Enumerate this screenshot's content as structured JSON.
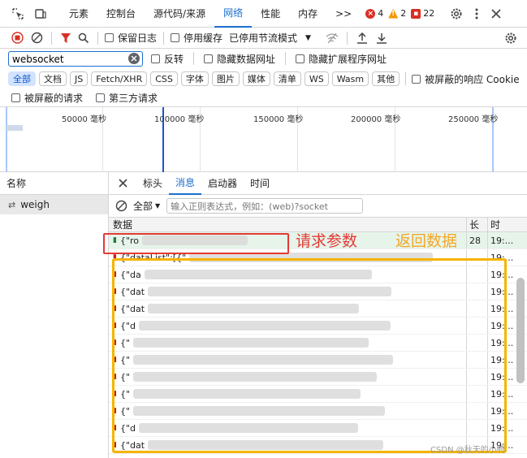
{
  "tabbar": {
    "tabs": [
      "元素",
      "控制台",
      "源代码/来源",
      "网络",
      "性能",
      "内存"
    ],
    "active_tab": "网络",
    "more": ">>",
    "errors": "4",
    "warnings": "2",
    "issues": "22"
  },
  "toolbar": {
    "preserve_log": "保留日志",
    "disable_cache": "停用缓存",
    "throttle": "已停用节流模式"
  },
  "filter": {
    "value": "websocket",
    "invert": "反转",
    "hide_data_urls": "隐藏数据网址",
    "hide_extension_urls": "隐藏扩展程序网址",
    "types": [
      "全部",
      "文档",
      "JS",
      "Fetch/XHR",
      "CSS",
      "字体",
      "图片",
      "媒体",
      "清单",
      "WS",
      "Wasm",
      "其他"
    ],
    "active_type": "全部",
    "blocked_cookies": "被屏蔽的响应 Cookie",
    "blocked_requests": "被屏蔽的请求",
    "third_party": "第三方请求"
  },
  "timeline": {
    "ticks": [
      "50000 毫秒",
      "100000 毫秒",
      "150000 毫秒",
      "200000 毫秒",
      "250000 毫秒"
    ]
  },
  "left_panel": {
    "header": "名称",
    "item": "weigh"
  },
  "detail": {
    "tabs": [
      "标头",
      "消息",
      "启动器",
      "时间"
    ],
    "active_tab": "消息",
    "message_filter": "全部",
    "regex_placeholder": "输入正则表达式，例如：(web)?socket"
  },
  "messages": {
    "col_data": "数据",
    "col_length": "长",
    "col_time": "时",
    "rows": [
      {
        "dir": "up",
        "data": "{\"ro",
        "length": "28",
        "time": "19:..."
      },
      {
        "dir": "down",
        "data": "{\"dataList\":[{\"",
        "length": "",
        "time": "19:..."
      },
      {
        "dir": "down",
        "data": "{\"da",
        "length": "",
        "time": "19:..."
      },
      {
        "dir": "down",
        "data": "{\"dat",
        "length": "",
        "time": "19:..."
      },
      {
        "dir": "down",
        "data": "{\"dat",
        "length": "",
        "time": "19:..."
      },
      {
        "dir": "down",
        "data": "{\"d",
        "length": "",
        "time": "19:..."
      },
      {
        "dir": "down",
        "data": "{\"",
        "length": "",
        "time": "19:..."
      },
      {
        "dir": "down",
        "data": "{\"",
        "length": "",
        "time": "19:..."
      },
      {
        "dir": "down",
        "data": "{\"",
        "length": "",
        "time": "19:..."
      },
      {
        "dir": "down",
        "data": "{\"",
        "length": "",
        "time": "19:..."
      },
      {
        "dir": "down",
        "data": "{\"",
        "length": "",
        "time": "19:..."
      },
      {
        "dir": "down",
        "data": "{\"d",
        "length": "",
        "time": "19:..."
      },
      {
        "dir": "down",
        "data": "{\"dat",
        "length": "",
        "time": "19:..."
      }
    ]
  },
  "annotations": {
    "request_params": "请求参数",
    "return_data": "返回数据",
    "red_color": "#e53935",
    "yellow_color": "#f5b400"
  },
  "watermark": "CSDN @秋天的小鸭"
}
